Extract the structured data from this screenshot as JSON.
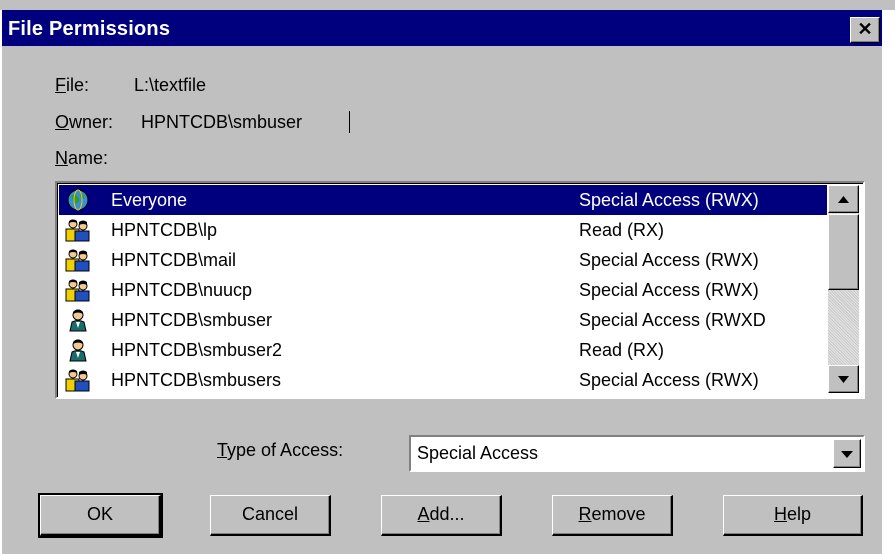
{
  "dialog": {
    "title": "File Permissions",
    "close_glyph": "✕"
  },
  "file": {
    "label": "File:",
    "value": "L:\\textfile"
  },
  "owner": {
    "label": "Owner:",
    "value": "HPNTCDB\\smbuser"
  },
  "name_label": "Name:",
  "permissions": [
    {
      "icon": "globe-icon",
      "name": "Everyone",
      "access": "Special Access (RWX)",
      "selected": true
    },
    {
      "icon": "group-icon",
      "name": "HPNTCDB\\lp",
      "access": "Read (RX)",
      "selected": false
    },
    {
      "icon": "group-icon",
      "name": "HPNTCDB\\mail",
      "access": "Special Access (RWX)",
      "selected": false
    },
    {
      "icon": "group-icon",
      "name": "HPNTCDB\\nuucp",
      "access": "Special Access (RWX)",
      "selected": false
    },
    {
      "icon": "user-icon",
      "name": "HPNTCDB\\smbuser",
      "access": "Special Access (RWXD",
      "selected": false
    },
    {
      "icon": "user-icon",
      "name": "HPNTCDB\\smbuser2",
      "access": "Read (RX)",
      "selected": false
    },
    {
      "icon": "group-icon",
      "name": "HPNTCDB\\smbusers",
      "access": "Special Access (RWX)",
      "selected": false
    }
  ],
  "type_of_access": {
    "label": "Type of Access:",
    "value": "Special Access"
  },
  "buttons": {
    "ok": "OK",
    "cancel": "Cancel",
    "add": "Add...",
    "remove": "Remove",
    "help": "Help"
  },
  "colors": {
    "titlebar": "#00007f",
    "face": "#c0c0c0",
    "selection": "#00007f"
  }
}
